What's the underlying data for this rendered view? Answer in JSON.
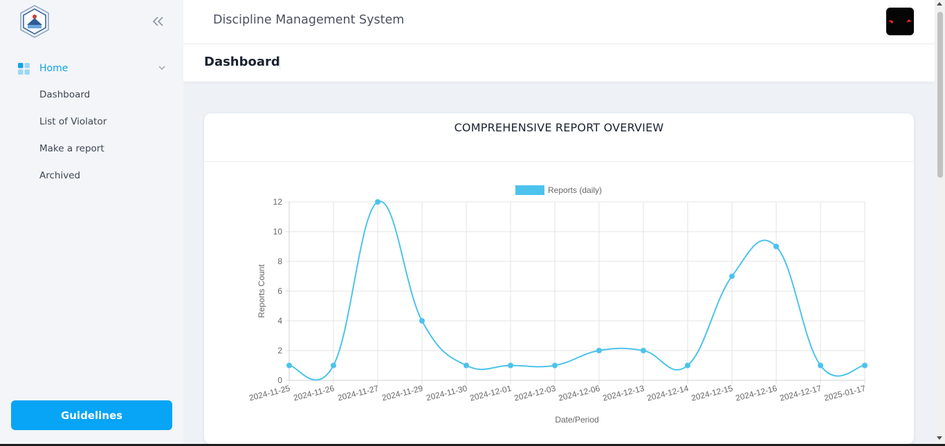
{
  "app": {
    "title": "Discipline Management System"
  },
  "sidebar": {
    "home_label": "Home",
    "items": [
      {
        "label": "Dashboard"
      },
      {
        "label": "List of Violator"
      },
      {
        "label": "Make a report"
      },
      {
        "label": "Archived"
      }
    ],
    "guidelines_label": "Guidelines"
  },
  "page": {
    "title": "Dashboard"
  },
  "card": {
    "title": "COMPREHENSIVE REPORT OVERVIEW"
  },
  "colors": {
    "accent": "#12a3e8",
    "button": "#08a4f5",
    "series": "#4cc3ec"
  },
  "chart_data": {
    "type": "line",
    "categories": [
      "2024-11-25",
      "2024-11-26",
      "2024-11-27",
      "2024-11-29",
      "2024-11-30",
      "2024-12-01",
      "2024-12-03",
      "2024-12-06",
      "2024-12-13",
      "2024-12-14",
      "2024-12-15",
      "2024-12-16",
      "2024-12-17",
      "2025-01-17"
    ],
    "series": [
      {
        "name": "Reports (daily)",
        "values": [
          1,
          1,
          12,
          4,
          1,
          1,
          1,
          2,
          2,
          1,
          7,
          9,
          1,
          1
        ]
      }
    ],
    "title": "",
    "xlabel": "Date/Period",
    "ylabel": "Reports Count",
    "ylim": [
      0,
      12
    ],
    "yticks": [
      0,
      2,
      4,
      6,
      8,
      10,
      12
    ],
    "grid": true,
    "legend": "top-center",
    "smooth": true
  }
}
